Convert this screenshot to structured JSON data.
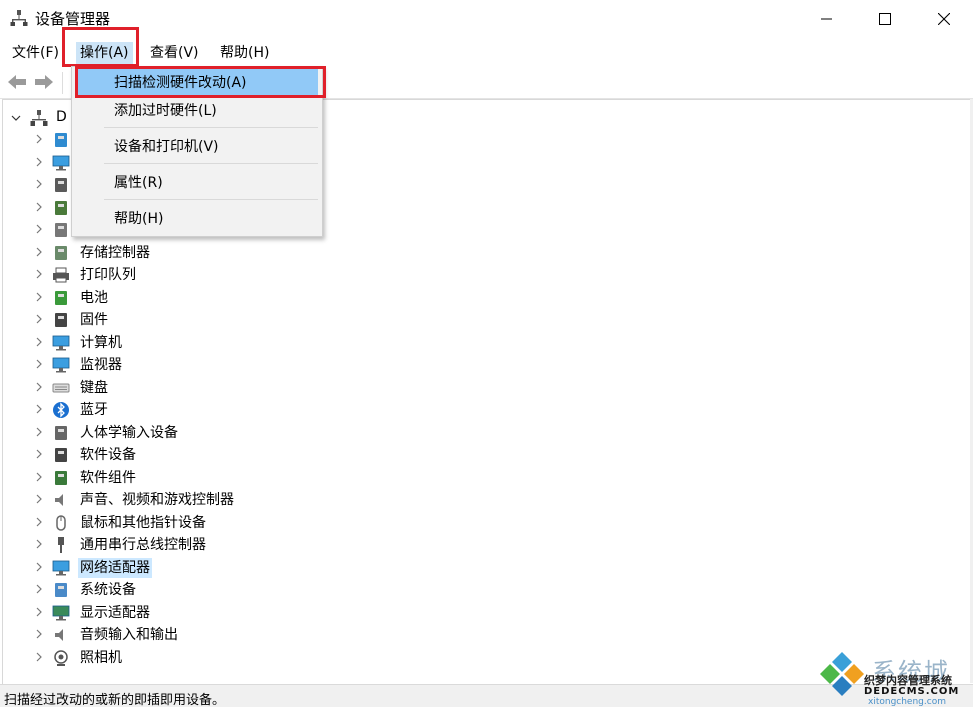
{
  "window": {
    "title": "设备管理器",
    "app_icon": "device-manager-icon"
  },
  "menubar": {
    "items": [
      {
        "label": "文件(F)"
      },
      {
        "label": "操作(A)"
      },
      {
        "label": "查看(V)"
      },
      {
        "label": "帮助(H)"
      }
    ]
  },
  "dropdown": {
    "items": [
      {
        "label": "扫描检测硬件改动(A)"
      },
      {
        "label": "添加过时硬件(L)"
      },
      {
        "label": "设备和打印机(V)"
      },
      {
        "label": "属性(R)"
      },
      {
        "label": "帮助(H)"
      }
    ]
  },
  "tree": {
    "root_label": "D",
    "nodes": [
      {
        "label": "",
        "icon": "network-icon"
      },
      {
        "label": "",
        "icon": "monitor-icon"
      },
      {
        "label": "",
        "icon": "chip-icon"
      },
      {
        "label": "",
        "icon": "processor-icon"
      },
      {
        "label": "",
        "icon": "drive-icon"
      },
      {
        "label": "存储控制器",
        "icon": "storage-controller-icon"
      },
      {
        "label": "打印队列",
        "icon": "printer-icon"
      },
      {
        "label": "电池",
        "icon": "battery-icon"
      },
      {
        "label": "固件",
        "icon": "firmware-icon"
      },
      {
        "label": "计算机",
        "icon": "computer-icon"
      },
      {
        "label": "监视器",
        "icon": "monitor-icon"
      },
      {
        "label": "键盘",
        "icon": "keyboard-icon"
      },
      {
        "label": "蓝牙",
        "icon": "bluetooth-icon"
      },
      {
        "label": "人体学输入设备",
        "icon": "hid-icon"
      },
      {
        "label": "软件设备",
        "icon": "software-device-icon"
      },
      {
        "label": "软件组件",
        "icon": "software-component-icon"
      },
      {
        "label": "声音、视频和游戏控制器",
        "icon": "speaker-icon"
      },
      {
        "label": "鼠标和其他指针设备",
        "icon": "mouse-icon"
      },
      {
        "label": "通用串行总线控制器",
        "icon": "usb-icon"
      },
      {
        "label": "网络适配器",
        "icon": "network-adapter-icon"
      },
      {
        "label": "系统设备",
        "icon": "system-device-icon"
      },
      {
        "label": "显示适配器",
        "icon": "display-adapter-icon"
      },
      {
        "label": "音频输入和输出",
        "icon": "audio-io-icon"
      },
      {
        "label": "照相机",
        "icon": "camera-icon"
      }
    ]
  },
  "status": {
    "text": "扫描经过改动的或新的即插即用设备。"
  },
  "watermark": {
    "brand": "系统城",
    "line1": "织梦内容管理系统",
    "line2": "DEDECMS.COM",
    "line3": "xitongcheng.com"
  },
  "colors": {
    "highlight_red": "#e0202a",
    "menu_active": "#cce4f7",
    "dropdown_active": "#91c9f7",
    "selected_row": "#cce8ff"
  }
}
